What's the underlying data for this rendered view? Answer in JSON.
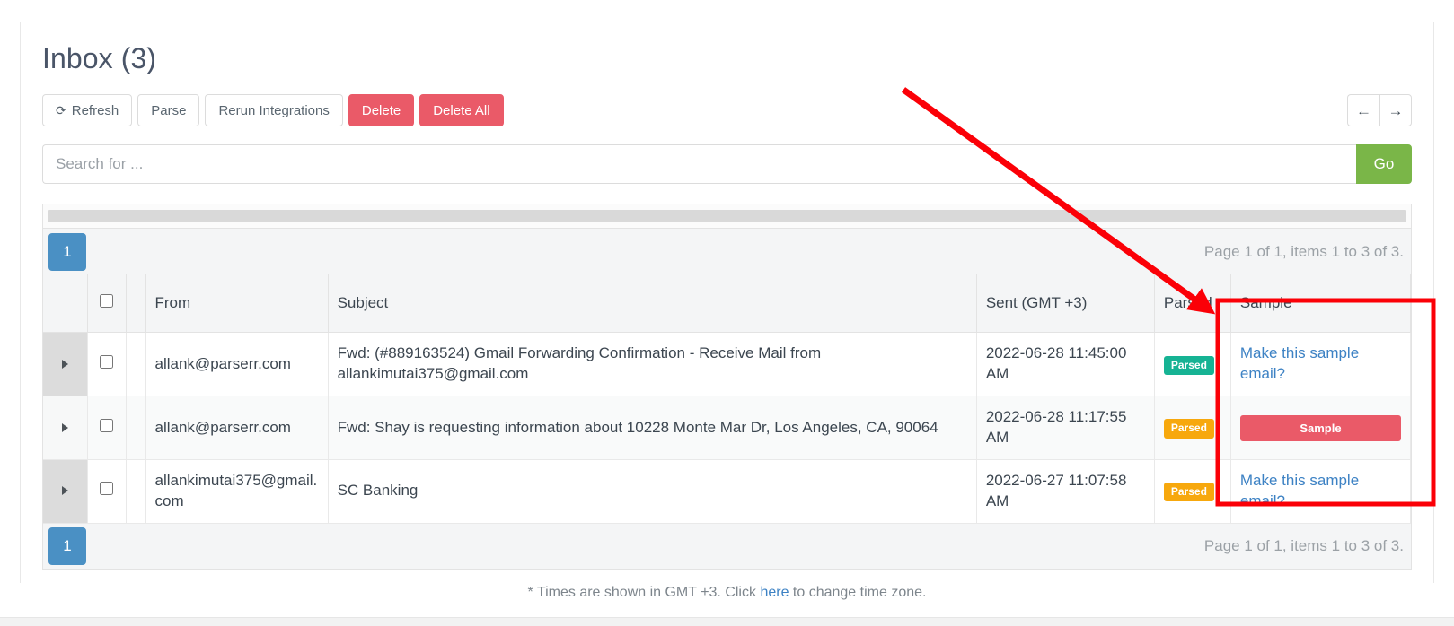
{
  "page": {
    "title": "Inbox (3)"
  },
  "toolbar": {
    "refresh_label": "Refresh",
    "refresh_icon": "refresh-icon",
    "parse_label": "Parse",
    "rerun_label": "Rerun Integrations",
    "delete_label": "Delete",
    "delete_all_label": "Delete All",
    "prev_icon": "←",
    "next_icon": "→"
  },
  "search": {
    "placeholder": "Search for ...",
    "value": "",
    "go_label": "Go"
  },
  "pager": {
    "page_number": "1",
    "info": "Page 1 of 1, items 1 to 3 of 3."
  },
  "table": {
    "columns": {
      "expand": "",
      "checkbox": "",
      "gap": "",
      "from": "From",
      "subject": "Subject",
      "sent": "Sent (GMT +3)",
      "parsed": "Parsed",
      "sample": "Sample"
    },
    "rows": [
      {
        "from": "allank@parserr.com",
        "subject": "Fwd: (#889163524) Gmail Forwarding Confirmation - Receive Mail from allankimutai375@gmail.com",
        "sent": "2022-06-28 11:45:00 AM",
        "parsed_badge": "Parsed",
        "parsed_color": "#16b394",
        "sample_type": "link",
        "sample_label": "Make this sample email?"
      },
      {
        "from": "allank@parserr.com",
        "subject": "Fwd: Shay is requesting information about 10228 Monte Mar Dr, Los Angeles, CA, 90064",
        "sent": "2022-06-28 11:17:55 AM",
        "parsed_badge": "Parsed",
        "parsed_color": "#f7a80d",
        "sample_type": "button",
        "sample_label": "Sample"
      },
      {
        "from": "allankimutai375@gmail.com",
        "subject": "SC Banking",
        "sent": "2022-06-27 11:07:58 AM",
        "parsed_badge": "Parsed",
        "parsed_color": "#f7a80d",
        "sample_type": "link",
        "sample_label": "Make this sample email?"
      }
    ]
  },
  "footnote": {
    "prefix": "* Times are shown in GMT +3. Click ",
    "link": "here",
    "suffix": " to change time zone."
  },
  "annotations": {
    "highlight_color": "#ff0000",
    "arrow_label": "arrow pointing to Sample column",
    "box_label": "highlight box around Sample column"
  },
  "colors": {
    "accent_blue": "#4a90c4",
    "danger": "#ea5a68",
    "success_green": "#7ab648",
    "teal": "#16b394",
    "orange": "#f7a80d",
    "link": "#3d82c4"
  }
}
